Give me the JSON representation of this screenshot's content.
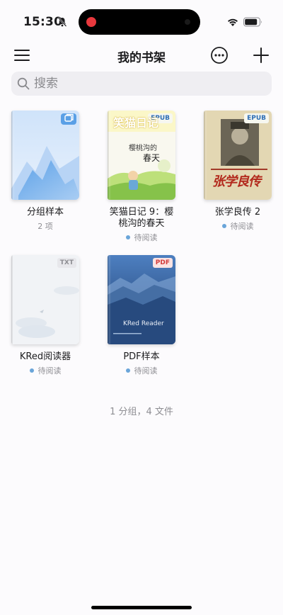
{
  "status": {
    "time": "15:30",
    "icons": [
      "bell-slash-icon",
      "record-icon",
      "wifi-icon",
      "battery-icon"
    ]
  },
  "nav": {
    "title": "我的书架",
    "icons": [
      "menu-icon",
      "more-icon",
      "plus-icon"
    ]
  },
  "search": {
    "placeholder": "搜索",
    "value": ""
  },
  "shelf": [
    {
      "title": "分组样本",
      "subtitle": "2 项",
      "type": "group"
    },
    {
      "title": "笑猫日记 9：樱桃沟的春天",
      "subtitle": "待阅读",
      "format": "EPUB",
      "cover_text": [
        "笑猫日记",
        "樱桃沟的",
        "春天"
      ]
    },
    {
      "title": "张学良传 2",
      "subtitle": "待阅读",
      "format": "EPUB",
      "cover_text": [
        "张学良传"
      ]
    },
    {
      "title": "KRed阅读器",
      "subtitle": "待阅读",
      "format": "TXT"
    },
    {
      "title": "PDF样本",
      "subtitle": "待阅读",
      "format": "PDF",
      "cover_text": [
        "KRed Reader"
      ]
    }
  ],
  "footer": "1 分组，4 文件",
  "colors": {
    "accent": "#5aa0e6",
    "status_dot": "#6aa5d9",
    "pdf_badge": "#d23b3b",
    "epub_badge": "#2f6fb5"
  }
}
